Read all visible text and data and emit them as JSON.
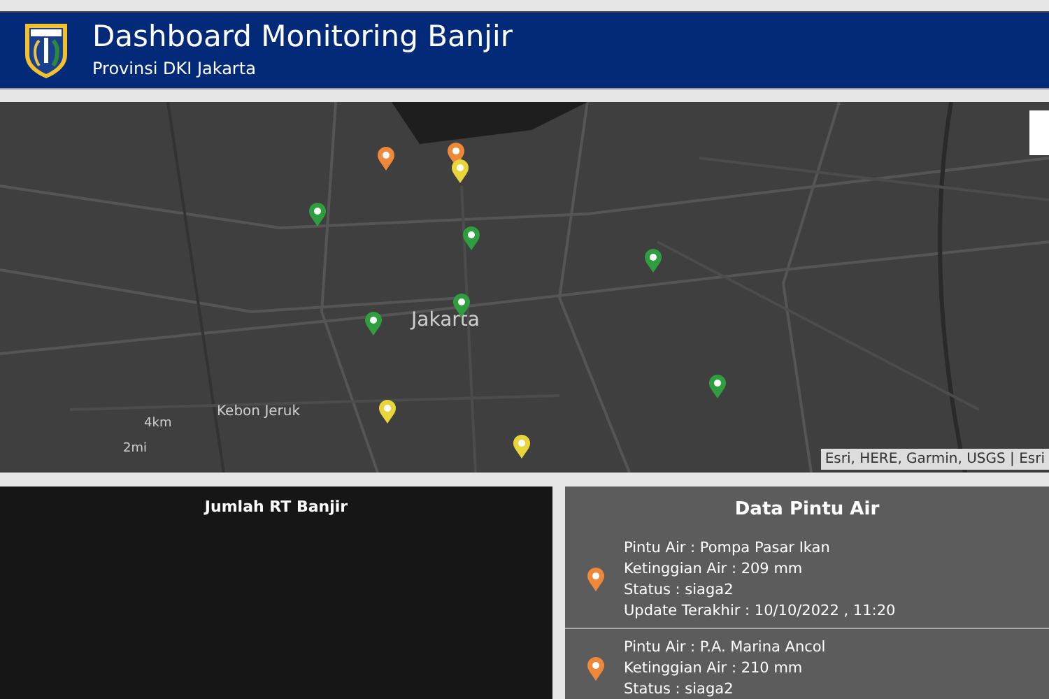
{
  "header": {
    "title": "Dashboard Monitoring Banjir",
    "subtitle": "Provinsi DKI Jakarta"
  },
  "map": {
    "labels": [
      {
        "text": "Jakarta",
        "kind": "city"
      },
      {
        "text": "Kebon Jeruk",
        "kind": "district"
      },
      {
        "text": "4km",
        "kind": "scale"
      },
      {
        "text": "2mi",
        "kind": "scale"
      }
    ],
    "pins": [
      {
        "color": "#f0883a"
      },
      {
        "color": "#f0883a"
      },
      {
        "color": "#e8d53a"
      },
      {
        "color": "#2e9e3e"
      },
      {
        "color": "#2e9e3e"
      },
      {
        "color": "#2e9e3e"
      },
      {
        "color": "#2e9e3e"
      },
      {
        "color": "#2e9e3e"
      },
      {
        "color": "#2e9e3e"
      },
      {
        "color": "#e8d53a"
      },
      {
        "color": "#e8d53a"
      }
    ],
    "attribution": "Esri, HERE, Garmin, USGS | Esri"
  },
  "rt_panel": {
    "title": "Jumlah RT Banjir"
  },
  "gate_panel": {
    "title": "Data Pintu Air",
    "items": [
      {
        "color": "#f0883a",
        "lines": [
          "Pintu Air : Pompa Pasar Ikan",
          "Ketinggian Air : 209 mm",
          "Status : siaga2",
          "Update Terakhir : 10/10/2022 , 11:20"
        ]
      },
      {
        "color": "#f0883a",
        "lines": [
          "Pintu Air : P.A. Marina Ancol",
          "Ketinggian Air : 210 mm",
          "Status : siaga2"
        ]
      }
    ]
  }
}
